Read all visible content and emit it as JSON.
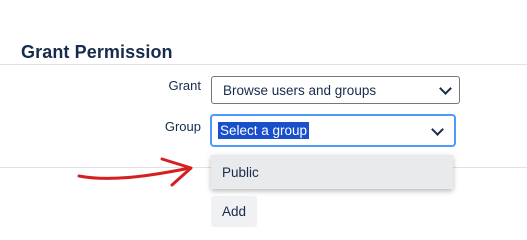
{
  "section": {
    "title": "Grant Permission"
  },
  "form": {
    "grant_label": "Grant",
    "grant_value": "Browse users and groups",
    "group_label": "Group",
    "group_value": "Select a group",
    "add_button_label": "Add"
  },
  "dropdown": {
    "options": [
      "Public"
    ]
  },
  "colors": {
    "focus_border": "#4c9aff",
    "selection_highlight": "#1a4fcc",
    "annotation_arrow": "#d42020"
  },
  "icons": {
    "select_arrow": "chevron-down-icon",
    "annotation": "arrow-right-icon"
  }
}
